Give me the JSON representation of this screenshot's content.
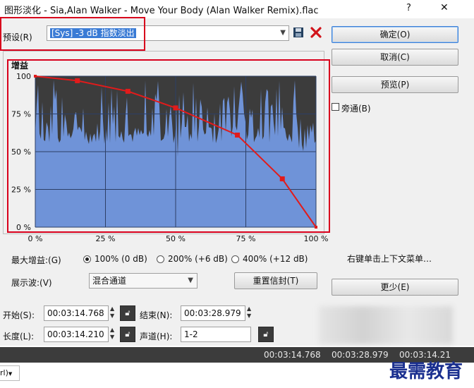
{
  "window": {
    "title": "图形淡化 - Sia,Alan Walker - Move Your Body (Alan Walker Remix).flac",
    "help_glyph": "?",
    "close_glyph": "✕"
  },
  "preset": {
    "label": "预设(R)",
    "value": "[Sys] -3 dB 指数淡出",
    "save_icon": "floppy-disk-icon",
    "delete_icon": "red-x-icon"
  },
  "buttons": {
    "ok": "确定(O)",
    "cancel": "取消(C)",
    "preview": "预览(P)",
    "reset_envelope": "重置信封(T)",
    "less": "更少(E)"
  },
  "bypass": {
    "label": "旁通(B)",
    "checked": false
  },
  "graph": {
    "title": "增益",
    "context_hint": "右键单击上下文菜单…"
  },
  "chart_data": {
    "type": "line",
    "title": "增益",
    "y_ticks": [
      "100",
      "75 %",
      "50 %",
      "25 %",
      "0 %"
    ],
    "x_ticks": [
      "0 %",
      "25 %",
      "50 %",
      "75 %",
      "100 %"
    ],
    "xlim": [
      0,
      100
    ],
    "ylim": [
      0,
      100
    ],
    "grid": true,
    "series": [
      {
        "x": [
          0,
          15,
          33,
          50,
          72,
          88,
          100
        ],
        "y": [
          100,
          97,
          90,
          79,
          61,
          32,
          0
        ]
      }
    ],
    "colors": {
      "line": "#e11b1b",
      "waveform": "#6f93d8",
      "background": "#3c3c3c",
      "grid": "#2d3f66"
    }
  },
  "max_gain": {
    "label": "最大增益:(G)",
    "options": [
      "100% (0 dB)",
      "200% (+6 dB)",
      "400% (+12 dB)"
    ],
    "selected": 0
  },
  "display_wave": {
    "label": "展示波:(V)",
    "value": "混合通道"
  },
  "time": {
    "start_label": "开始(S):",
    "start_value": "00:03:14.768",
    "end_label": "结束(N):",
    "end_value": "00:03:28.979",
    "length_label": "长度(L):",
    "length_value": "00:03:14.210",
    "channel_label": "声道(H):",
    "channel_value": "1-2"
  },
  "status_bar": {
    "start": "00:03:14.768",
    "end": "00:03:28.979",
    "partial": "00:03:14.21"
  },
  "bottom": {
    "dropdown_fragment": "rl)",
    "watermark": "最需教育"
  }
}
